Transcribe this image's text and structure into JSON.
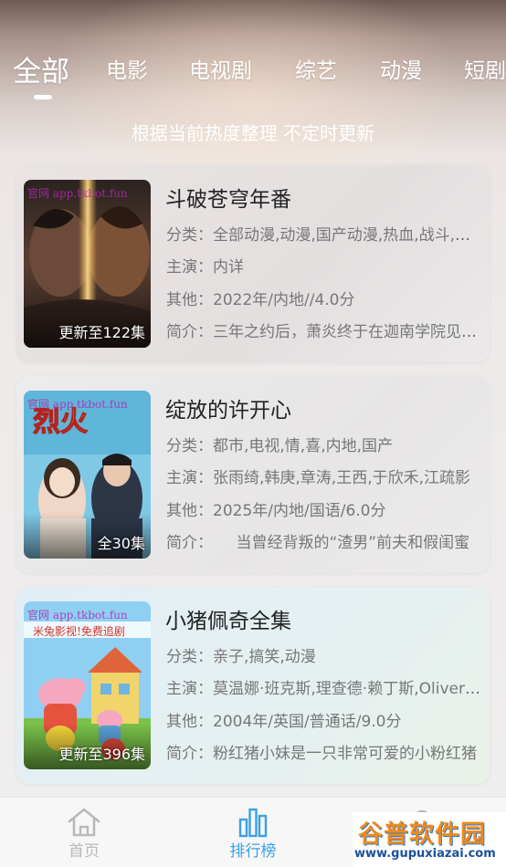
{
  "tabs": [
    {
      "label": "全部",
      "active": true
    },
    {
      "label": "电影",
      "active": false
    },
    {
      "label": "电视剧",
      "active": false
    },
    {
      "label": "综艺",
      "active": false
    },
    {
      "label": "动漫",
      "active": false
    },
    {
      "label": "短剧",
      "active": false
    }
  ],
  "subtitle": "根据当前热度整理 不定时更新",
  "items": [
    {
      "title": "斗破苍穹年番",
      "category_label": "分类：",
      "category": "全部动漫,动漫,国产动漫,热血,战斗,玄幻",
      "cast_label": "主演：",
      "cast": "内详",
      "other_label": "其他：",
      "other": "2022年/内地//4.0分",
      "intro_label": "简介：",
      "intro": "三年之约后，萧炎终于在迦南学院见到了熏儿",
      "badge": "更新至122集",
      "poster_watermark": "官网 app.tkbot.fun"
    },
    {
      "title": "绽放的许开心",
      "category_label": "分类：",
      "category": "都市,电视,情,喜,内地,国产",
      "cast_label": "主演：",
      "cast": "张雨绮,韩庚,章涛,王西,于欣禾,江疏影",
      "other_label": "其他：",
      "other": "2025年/内地/国语/6.0分",
      "intro_label": "简介：",
      "intro": "　　当曾经背叛的“渣男”前夫和假闺蜜",
      "badge": "全30集",
      "poster_watermark": "官网 app.tkbot.fun"
    },
    {
      "title": "小猪佩奇全集",
      "category_label": "分类：",
      "category": "亲子,搞笑,动漫",
      "cast_label": "主演：",
      "cast": "莫温娜·班克斯,理查德·赖丁斯,Oliver May",
      "other_label": "其他：",
      "other": "2004年/英国/普通话/9.0分",
      "intro_label": "简介：",
      "intro": "粉红猪小妹是一只非常可爱的小粉红猪",
      "badge": "更新至396集",
      "poster_watermark": "官网 app.tkbot.fun",
      "poster_caption": "米兔影视!免费追剧"
    }
  ],
  "nav": {
    "home_label": "首页",
    "rank_label": "排行榜"
  },
  "site_watermark": {
    "brand": "谷普软件园",
    "url": "www.gupuxiazai.com"
  },
  "colors": {
    "accent": "#3aa0e6",
    "inactive": "#b9b9b9"
  }
}
